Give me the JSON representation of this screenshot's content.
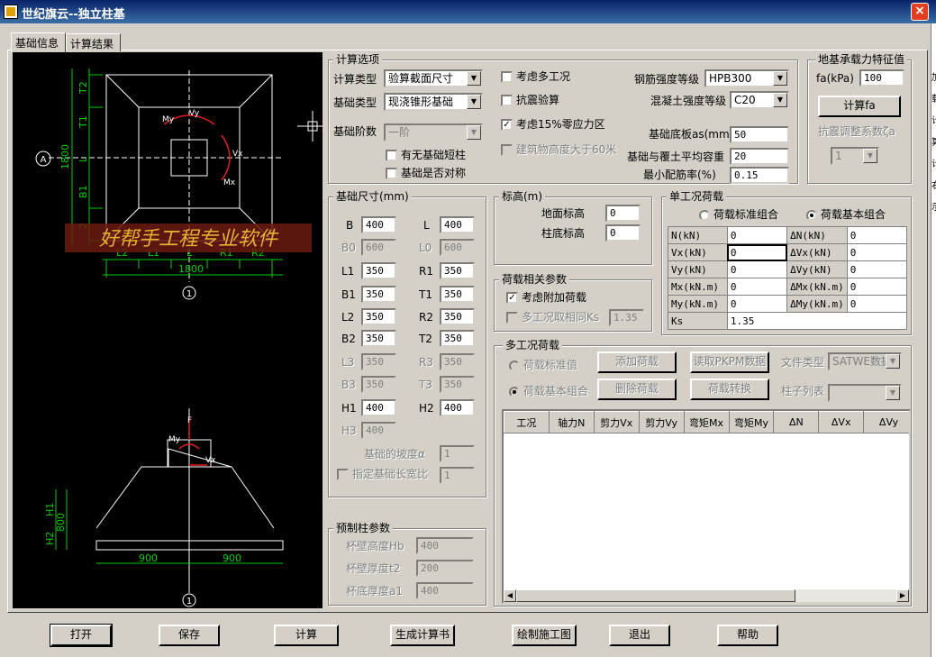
{
  "window": {
    "title": "世纪旗云--独立柱基",
    "close": "×"
  },
  "tabs": [
    "基础信息",
    "计算结果"
  ],
  "drawing": {
    "plan": {
      "T2": "T2",
      "T1": "T1",
      "L": "L",
      "B1": "B1",
      "B2": "2",
      "dim1800v": "1800",
      "A": "A",
      "My": "My",
      "Vy": "Vy",
      "Vx": "Vx",
      "Mx": "Mx",
      "L2": "L2",
      "L1": "L1",
      "Lm": "L",
      "R1": "R1",
      "R2": "R2",
      "dim1800h": "1800",
      "axis1": "1"
    },
    "section": {
      "F": "F",
      "My": "My",
      "Vx": "Vx",
      "H1": "H1",
      "H2": "H2",
      "dim800": "800",
      "d900a": "900",
      "d900b": "900",
      "axis1": "1"
    },
    "watermark": "好帮手工程专业软件"
  },
  "calc_opts": {
    "title": "计算选项",
    "calc_type_label": "计算类型",
    "calc_type": "验算截面尺寸",
    "found_type_label": "基础类型",
    "found_type": "现浇锥形基础",
    "steps_label": "基础阶数",
    "steps": "一阶",
    "short_col": "有无基础短柱",
    "symmetric": "基础是否对称",
    "multi": "考虑多工况",
    "seismic": "抗震验算",
    "zero15": "考虑15%零应力区",
    "over60": "建筑物高度大于60米",
    "steel_label": "钢筋强度等级",
    "steel": "HPB300",
    "concrete_label": "混凝土强度等级",
    "concrete": "C20",
    "as_label": "基础底板as(mm)",
    "as": "50",
    "gamma_label": "基础与覆土平均容重",
    "gamma": "20",
    "rho_label": "最小配筋率(%)",
    "rho": "0.15",
    "check": "✓"
  },
  "bearing": {
    "title": "地基承载力特征值",
    "fa_label": "fa(kPa)",
    "fa": "100",
    "calc_btn": "计算fa",
    "adj_label": "抗震调整系数ζa",
    "adj": "1"
  },
  "size": {
    "title": "基础尺寸(mm)",
    "rows": [
      [
        {
          "l": "B",
          "v": "400"
        },
        {
          "l": "L",
          "v": "400"
        }
      ],
      [
        {
          "l": "B0",
          "v": "600",
          "d": true
        },
        {
          "l": "L0",
          "v": "600",
          "d": true
        }
      ],
      [
        {
          "l": "L1",
          "v": "350"
        },
        {
          "l": "R1",
          "v": "350"
        }
      ],
      [
        {
          "l": "B1",
          "v": "350"
        },
        {
          "l": "T1",
          "v": "350"
        }
      ],
      [
        {
          "l": "L2",
          "v": "350"
        },
        {
          "l": "R2",
          "v": "350"
        }
      ],
      [
        {
          "l": "B2",
          "v": "350"
        },
        {
          "l": "T2",
          "v": "350"
        }
      ],
      [
        {
          "l": "L3",
          "v": "350",
          "d": true
        },
        {
          "l": "R3",
          "v": "350",
          "d": true
        }
      ],
      [
        {
          "l": "B3",
          "v": "350",
          "d": true
        },
        {
          "l": "T3",
          "v": "350",
          "d": true
        }
      ],
      [
        {
          "l": "H1",
          "v": "400"
        },
        {
          "l": "H2",
          "v": "400"
        }
      ],
      [
        {
          "l": "H3",
          "v": "400",
          "d": true
        }
      ]
    ],
    "slope_label": "基础的坡度α",
    "slope": "1",
    "ratio_label": "指定基础长宽比",
    "ratio": "1"
  },
  "elev": {
    "title": "标高(m)",
    "ground_label": "地面标高",
    "ground": "0",
    "colbot_label": "柱底标高",
    "colbot": "0"
  },
  "load_params": {
    "title": "荷载相关参数",
    "extra": "考虑附加荷载",
    "ks_label": "多工况取相同Ks",
    "ks": "1.35"
  },
  "precast": {
    "title": "预制柱参数",
    "hb_label": "杯壁高度Hb",
    "hb": "400",
    "t2_label": "杯壁厚度t2",
    "t2": "200",
    "a1_label": "杯底厚度a1",
    "a1": "400"
  },
  "single": {
    "title": "单工况荷载",
    "std": "荷载标准组合",
    "basic": "荷载基本组合",
    "rows": [
      [
        "N(kN)",
        "0",
        "ΔN(kN)",
        "0"
      ],
      [
        "Vx(kN)",
        "0",
        "ΔVx(kN)",
        "0"
      ],
      [
        "Vy(kN)",
        "0",
        "ΔVy(kN)",
        "0"
      ],
      [
        "Mx(kN.m)",
        "0",
        "ΔMx(kN.m)",
        "0"
      ],
      [
        "My(kN.m)",
        "0",
        "ΔMy(kN.m)",
        "0"
      ]
    ],
    "ks_label": "Ks",
    "ks": "1.35"
  },
  "multi": {
    "title": "多工况荷载",
    "std": "荷载标准值",
    "basic": "荷载基本组合",
    "add": "添加荷载",
    "del": "删除荷载",
    "read": "读取PKPM数据",
    "convert": "荷载转换",
    "file_label": "文件类型",
    "file": "SATWE数据",
    "col_label": "柱子列表",
    "col": "",
    "cols": [
      "工况",
      "轴力N",
      "剪力Vx",
      "剪力Vy",
      "弯矩Mx",
      "弯矩My",
      "ΔN",
      "ΔVx",
      "ΔVy"
    ],
    "left": "◀",
    "right": "▶"
  },
  "buttons": {
    "open": "打开",
    "save": "保存",
    "calc": "计算",
    "report": "生成计算书",
    "draw": "绘制施工图",
    "exit": "退出",
    "help": "帮助"
  },
  "side_chars": [
    "加",
    "载",
    "计",
    "算",
    "计",
    "右",
    "示"
  ]
}
